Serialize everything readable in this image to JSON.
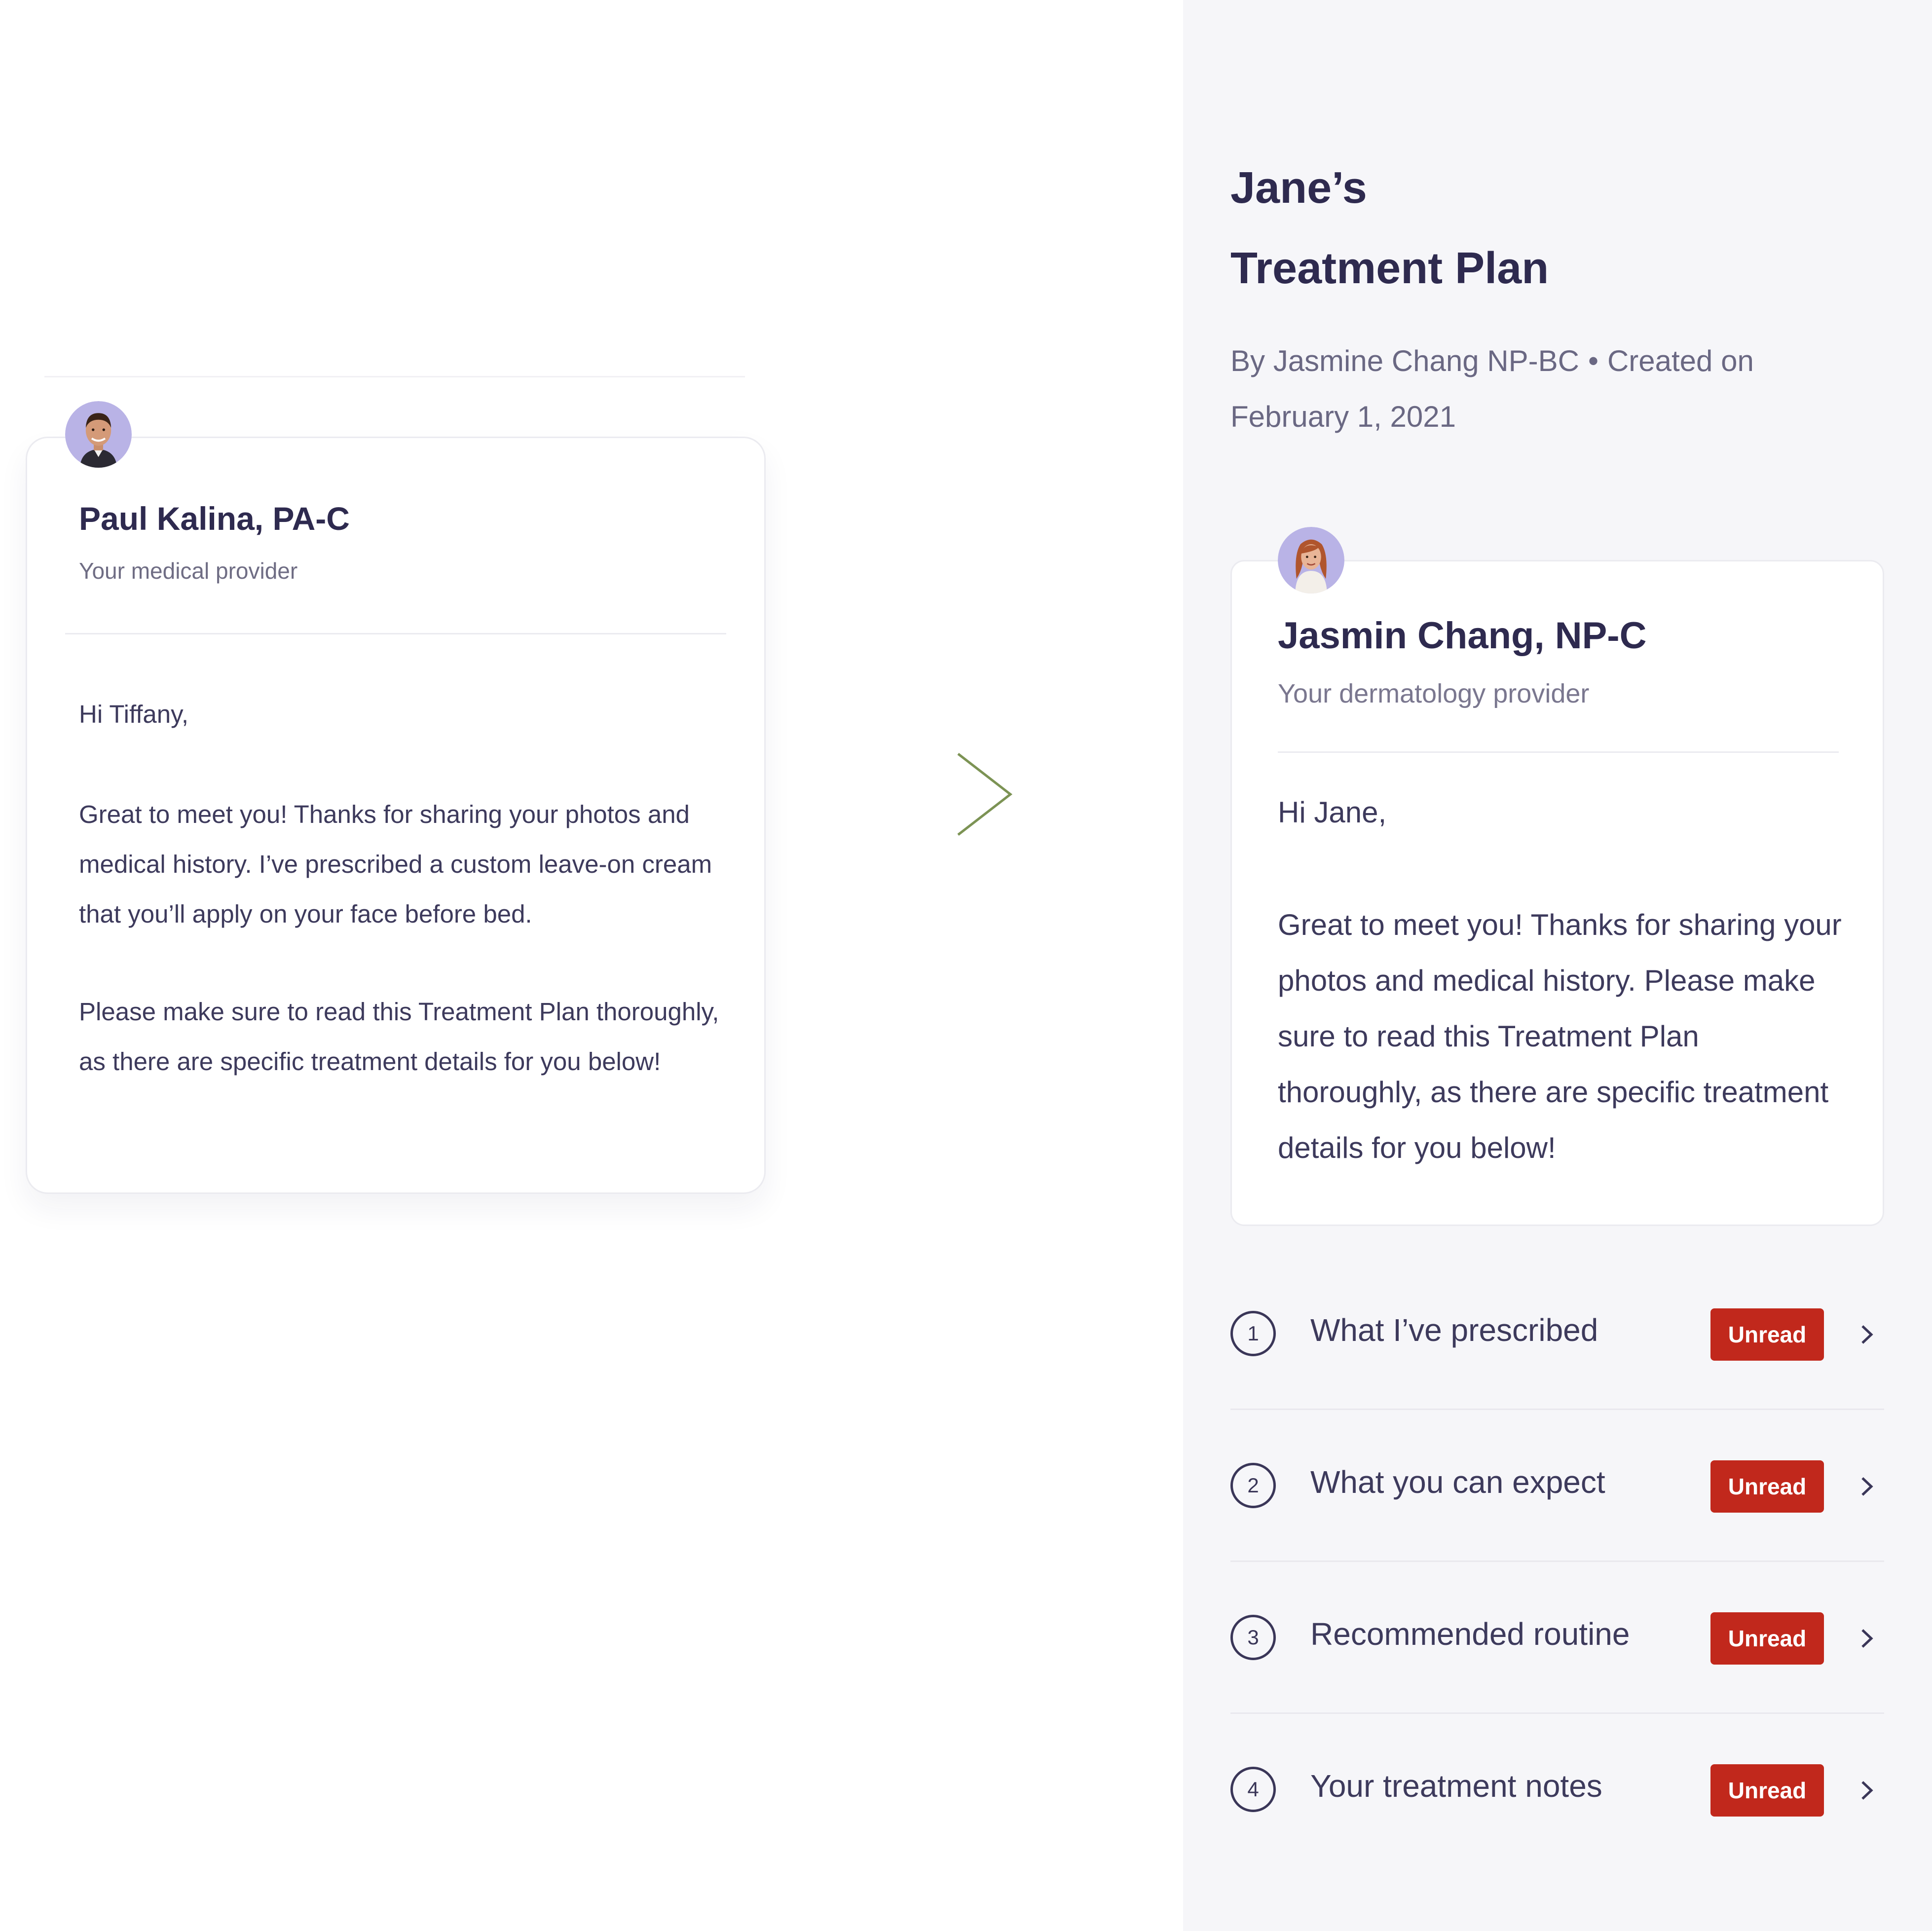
{
  "left_card": {
    "provider_name": "Paul Kalina, PA-C",
    "provider_role": "Your medical provider",
    "greeting": "Hi Tiffany,",
    "paragraph_1": "Great to meet you! Thanks for sharing your photos and medical history. I’ve prescribed a custom leave-on cream that you’ll apply on your face before bed.",
    "paragraph_2": "Please make sure to read this Treatment Plan thoroughly, as there are specific treatment details for you below!",
    "avatar_icon": "male-provider-avatar"
  },
  "transition": {
    "icon": "chevron-right-icon",
    "color": "#7c9354"
  },
  "plan": {
    "title_line_1": "Jane’s",
    "title_line_2": "Treatment Plan",
    "author": "By Jasmine Chang NP-BC",
    "separator": "•",
    "created_label": "Created on",
    "created_date": "February 1, 2021",
    "background_color": "#f6f6f9"
  },
  "right_card": {
    "provider_name": "Jasmin Chang, NP-C",
    "provider_role": "Your dermatology provider",
    "greeting": "Hi Jane,",
    "paragraph": "Great to meet you! Thanks for sharing your photos and medical history. Please make sure to read this Treatment Plan thoroughly, as there are specific treatment details for you below!",
    "avatar_icon": "female-provider-avatar"
  },
  "sections": [
    {
      "number": "1",
      "label": "What I’ve prescribed",
      "status": "Unread"
    },
    {
      "number": "2",
      "label": "What you can expect",
      "status": "Unread"
    },
    {
      "number": "3",
      "label": "Recommended routine",
      "status": "Unread"
    },
    {
      "number": "4",
      "label": "Your treatment notes",
      "status": "Unread"
    }
  ],
  "colors": {
    "heading": "#2e2a4f",
    "badge_unread": "#c1281c",
    "avatar_bg": "#b9b3e6"
  }
}
